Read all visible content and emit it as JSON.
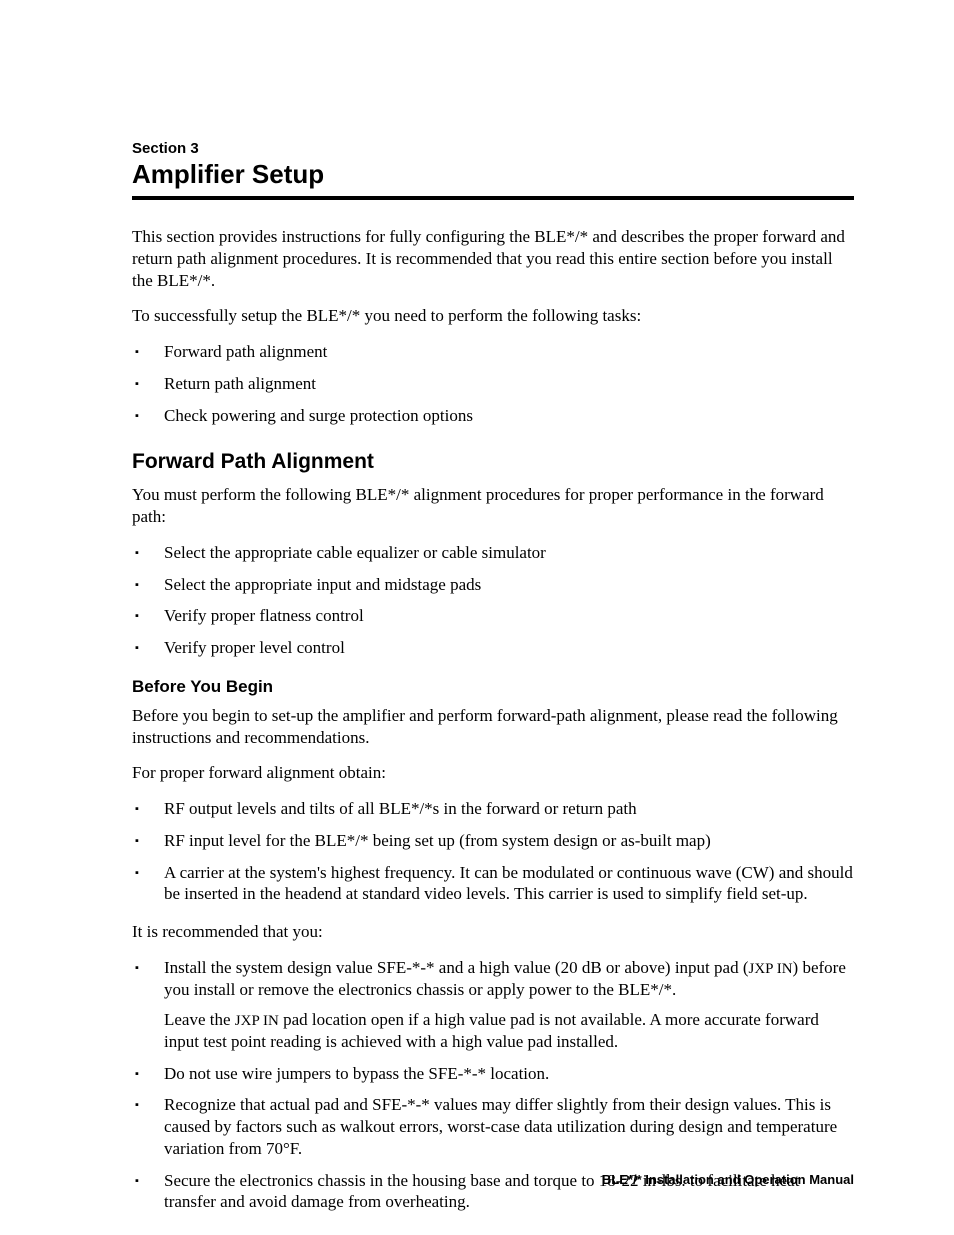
{
  "section_label": "Section 3",
  "section_title": "Amplifier Setup",
  "intro_p1": "This section provides instructions for fully configuring the BLE*/* and describes the proper forward and return path alignment procedures. It is recommended that you read this entire section before you install the BLE*/*.",
  "intro_p2": "To successfully setup the BLE*/* you need to perform the following tasks:",
  "tasks": [
    "Forward path alignment",
    "Return path alignment",
    "Check powering and surge protection options"
  ],
  "fpa_heading": "Forward Path Alignment",
  "fpa_intro": "You must perform the following BLE*/* alignment procedures for proper performance in the forward path:",
  "fpa_items": [
    "Select the appropriate cable equalizer or cable simulator",
    "Select the appropriate input and midstage pads",
    "Verify proper flatness control",
    "Verify proper level control"
  ],
  "byb_heading": "Before You Begin",
  "byb_p1": "Before you begin to set-up the amplifier and perform forward-path alignment, please read the following instructions and recommendations.",
  "byb_p2": "For proper forward alignment obtain:",
  "obtain_items": [
    "RF output levels and tilts of all BLE*/*s in the forward or return path",
    "RF input level for the BLE*/* being set up (from system design or as-built map)",
    "A carrier at the system's highest frequency. It can be modulated or continuous wave (CW) and should be inserted in the headend at standard video levels. This carrier is used to simplify field set-up."
  ],
  "rec_intro": "It is recommended that you:",
  "rec_items": {
    "r1_a": "Install the system design value SFE-*-* and a high value (20 dB or above) input pad (",
    "r1_b": "JXP IN",
    "r1_c": ") before you install or remove the electronics chassis or apply power to the BLE*/*.",
    "r1_sub_a": "Leave the ",
    "r1_sub_b": "JXP IN",
    "r1_sub_c": " pad location open if a high value pad is not available. A more accurate forward input test point reading is achieved with a high value pad installed.",
    "r2": "Do not use wire jumpers to bypass the SFE-*-* location.",
    "r3": "Recognize that actual pad and SFE-*-* values may differ slightly from their design values. This is caused by factors such as walkout errors, worst-case data utilization during design and temperature variation from 70°F.",
    "r4": "Secure the electronics chassis in the housing base and torque to 18-22 in-lbs. to facilitate heat transfer and avoid damage from overheating."
  },
  "footer": "BLE*/* Installation and Operation Manual"
}
